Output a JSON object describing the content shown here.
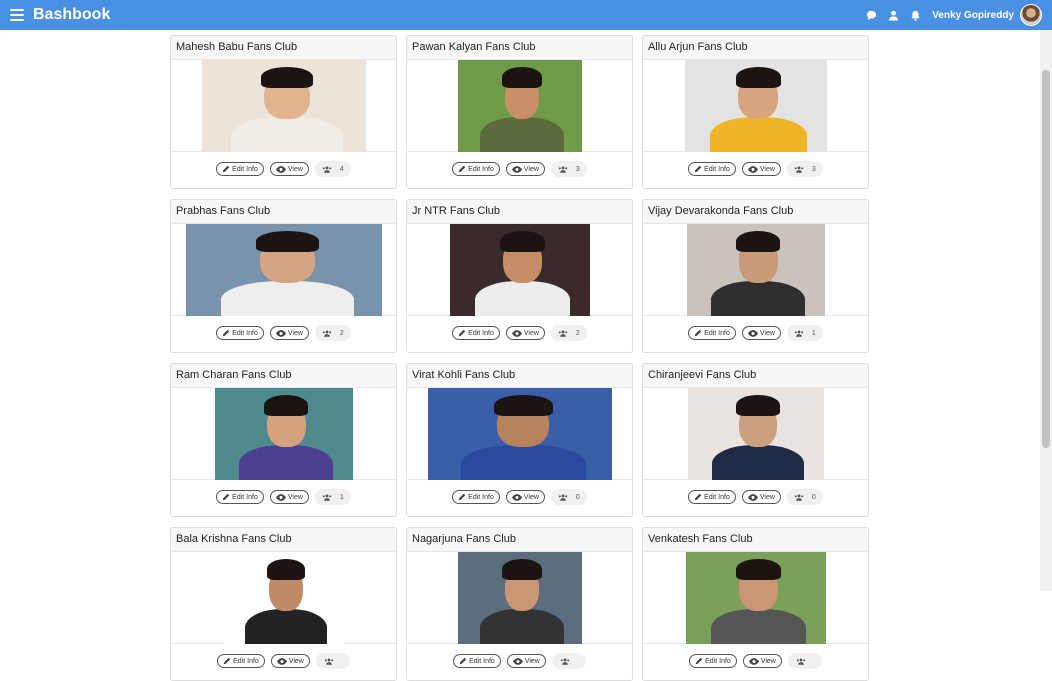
{
  "app": {
    "brand": "Bashbook"
  },
  "header": {
    "username": "Venky Gopireddy",
    "icons": [
      "comment-icon",
      "user-icon",
      "bell-icon"
    ]
  },
  "colors": {
    "topbar": "#4a90e2"
  },
  "labels": {
    "edit": "Edit Info",
    "view": "View"
  },
  "clubs": [
    {
      "name": "Mahesh Babu Fans Club",
      "members": "4",
      "photo_width": 164,
      "bg": "#ece4d8",
      "skin": "#e0b48e",
      "shirt": "#f2ede4"
    },
    {
      "name": "Pawan Kalyan Fans Club",
      "members": "3",
      "photo_width": 124,
      "bg": "#6f9a4a",
      "skin": "#c98f67",
      "shirt": "#5a6b3c"
    },
    {
      "name": "Allu Arjun Fans Club",
      "members": "3",
      "photo_width": 142,
      "bg": "#e3e3e3",
      "skin": "#d8a47e",
      "shirt": "#f0b429"
    },
    {
      "name": "Prabhas Fans Club",
      "members": "2",
      "photo_width": 196,
      "bg": "#7a93ad",
      "skin": "#d7a483",
      "shirt": "#eeeeee"
    },
    {
      "name": "Jr NTR Fans Club",
      "members": "2",
      "photo_width": 140,
      "bg": "#3a2a2a",
      "skin": "#c68e66",
      "shirt": "#ececec"
    },
    {
      "name": "Vijay Devarakonda Fans Club",
      "members": "1",
      "photo_width": 138,
      "bg": "#c9c3bc",
      "skin": "#c79a79",
      "shirt": "#2f2f2f"
    },
    {
      "name": "Ram Charan Fans Club",
      "members": "1",
      "photo_width": 138,
      "bg": "#4f8a8e",
      "skin": "#d5a07d",
      "shirt": "#4b3f8f"
    },
    {
      "name": "Virat Kohli Fans Club",
      "members": "0",
      "photo_width": 184,
      "bg": "#3a5fa8",
      "skin": "#b7835d",
      "shirt": "#2a4aa0"
    },
    {
      "name": "Chiranjeevi Fans Club",
      "members": "0",
      "photo_width": 136,
      "bg": "#e9e4e0",
      "skin": "#caa07e",
      "shirt": "#1f2a44"
    },
    {
      "name": "Bala Krishna Fans Club",
      "members": "",
      "photo_width": 120,
      "bg": "#ffffff",
      "skin": "#c08a66",
      "shirt": "#222222"
    },
    {
      "name": "Nagarjuna Fans Club",
      "members": "",
      "photo_width": 124,
      "bg": "#5b6e80",
      "skin": "#c99573",
      "shirt": "#333333"
    },
    {
      "name": "Venkatesh Fans Club",
      "members": "",
      "photo_width": 140,
      "bg": "#7aa05a",
      "skin": "#c99573",
      "shirt": "#555555"
    }
  ]
}
